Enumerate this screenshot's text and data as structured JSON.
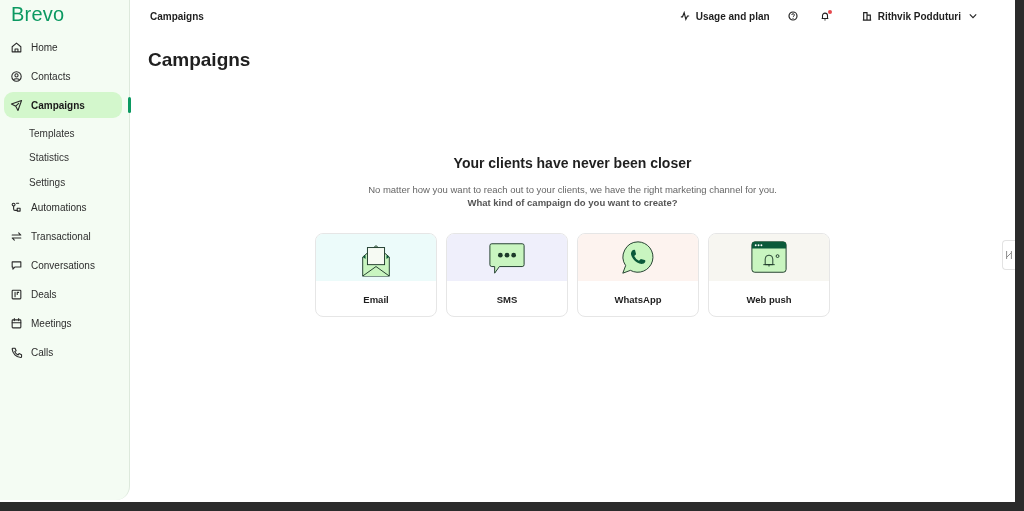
{
  "sidebar": {
    "logo": "Brevo",
    "items": [
      {
        "kind": "item",
        "label": "Home",
        "selected": false
      },
      {
        "kind": "item",
        "label": "Contacts",
        "selected": false
      },
      {
        "kind": "item",
        "label": "Campaigns",
        "selected": true
      },
      {
        "kind": "sub",
        "label": "Templates",
        "selected": false
      },
      {
        "kind": "sub",
        "label": "Statistics",
        "selected": false
      },
      {
        "kind": "sub",
        "label": "Settings",
        "selected": false
      },
      {
        "kind": "item",
        "label": "Automations",
        "selected": false
      },
      {
        "kind": "item",
        "label": "Transactional",
        "selected": false
      },
      {
        "kind": "item",
        "label": "Conversations",
        "selected": false
      },
      {
        "kind": "item",
        "label": "Deals",
        "selected": false
      },
      {
        "kind": "item",
        "label": "Meetings",
        "selected": false
      },
      {
        "kind": "item",
        "label": "Calls",
        "selected": false
      }
    ]
  },
  "header": {
    "breadcrumb": "Campaigns",
    "usage": "Usage and plan",
    "notification_dot": true,
    "user": "Rithvik Podduturi"
  },
  "page": {
    "title": "Campaigns",
    "heading": "Your clients have never been closer",
    "subtitle": "No matter how you want to reach out to your clients, we have the right marketing channel for you.",
    "question": "What kind of campaign do you want to create?",
    "cards": [
      {
        "kind": "email",
        "label": "Email",
        "color": "#ecfbfa"
      },
      {
        "kind": "sms",
        "label": "SMS",
        "color": "#efeffb"
      },
      {
        "kind": "whatsapp",
        "label": "WhatsApp",
        "color": "#fdf3ef"
      },
      {
        "kind": "webpush",
        "label": "Web push",
        "color": "#f7f6f1"
      }
    ]
  }
}
